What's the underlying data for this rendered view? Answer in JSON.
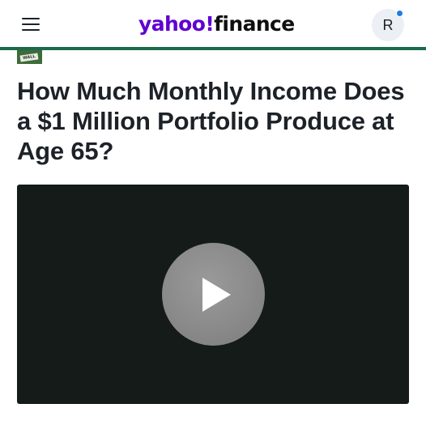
{
  "header": {
    "logo_part1": "yahoo!",
    "logo_part2": "finance",
    "avatar_initial": "R",
    "accent_bar_color": "#1b6b4b",
    "notification_dot_color": "#1f7ce4",
    "menu_icon": "hamburger-menu-icon"
  },
  "article": {
    "source_logo_text": "WALL",
    "title": "How Much Monthly Income Does a $1 Million Portfolio Produce at Age 65?"
  },
  "video": {
    "background_color": "#151b18",
    "play_icon": "play-icon"
  }
}
